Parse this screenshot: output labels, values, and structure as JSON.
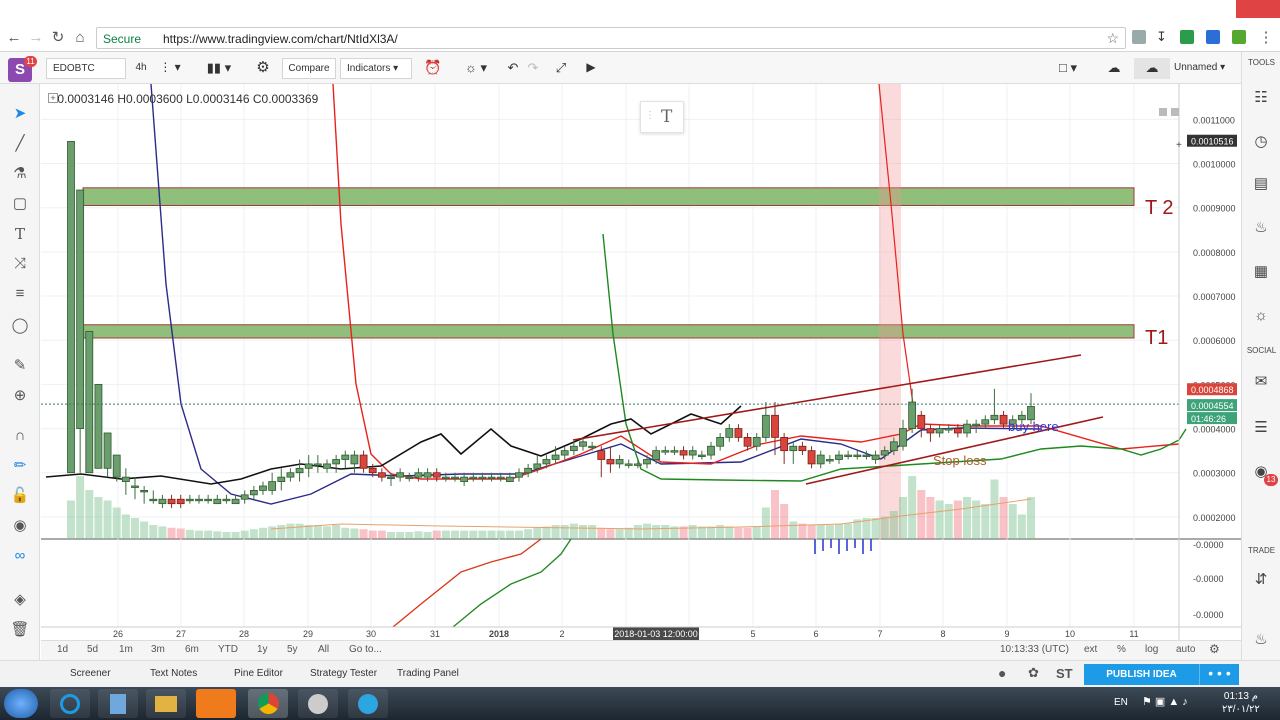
{
  "browser": {
    "secure_label": "Secure",
    "url": "https://www.tradingview.com/chart/NtIdXl3A/"
  },
  "toolbar": {
    "symbol": "EDOBTC",
    "interval": "4h",
    "compare_label": "Compare",
    "indicators_label": "Indicators",
    "layout_name": "Unnamed",
    "notification_count": "11"
  },
  "legend": {
    "ohlc": "O0.0003146  H0.0003600  L0.0003146  C0.0003369"
  },
  "text_tool_glyph": "T",
  "right_rail": {
    "tools_label": "TOOLS",
    "social_label": "SOCIAL",
    "trade_label": "TRADE",
    "social_badge": "13"
  },
  "bottom_bar": {
    "ranges": [
      "1d",
      "5d",
      "1m",
      "3m",
      "6m",
      "YTD",
      "1y",
      "5y",
      "All"
    ],
    "goto_label": "Go to...",
    "time_utc": "10:13:33 (UTC)",
    "ext_label": "ext",
    "pct_label": "%",
    "log_label": "log",
    "auto_label": "auto"
  },
  "footer": {
    "tabs": [
      "Screener",
      "Text Notes",
      "Pine Editor",
      "Strategy Tester",
      "Trading Panel"
    ],
    "st_label": "ST",
    "publish_label": "PUBLISH IDEA",
    "more_label": "• • •"
  },
  "taskbar": {
    "lang": "EN",
    "time": "01:13 م",
    "date": "٢٣/٠١/٢٢"
  },
  "colors": {
    "up_candle": "#6a9e6c",
    "down_candle": "#d9453b",
    "target_zone": "#8fbf7a",
    "accent_blue": "#1e9be6",
    "trendline": "#a01818"
  },
  "chart_data": {
    "type": "candlestick",
    "symbol": "EDOBTC",
    "interval": "4h",
    "x_tick_labels": [
      "26",
      "27",
      "28",
      "29",
      "30",
      "31",
      "2018",
      "2",
      "2018-01-03 12:00:00",
      "5",
      "6",
      "7",
      "8",
      "9",
      "10",
      "11"
    ],
    "y_tick_labels": [
      "0.0011000",
      "0.0010000",
      "0.0009000",
      "0.0008000",
      "0.0007000",
      "0.0006000",
      "0.0005000",
      "0.0004000",
      "0.0003000",
      "0.0002000"
    ],
    "ylim": [
      0.00015,
      0.00118
    ],
    "price_labels": [
      "0.0010516",
      "0.0004868",
      "0.0004554",
      "01:46:26"
    ],
    "oscillator_tick_labels": [
      "-0.0000",
      "-0.0000",
      "-0.0000"
    ],
    "annotations": {
      "t2_label": "T 2",
      "t1_label": "T1",
      "buy_label": "buy here",
      "stop_label": "Stop loss"
    },
    "zones": [
      {
        "name": "T 2",
        "low": 0.000905,
        "high": 0.000945
      },
      {
        "name": "T1",
        "low": 0.000605,
        "high": 0.000635
      }
    ],
    "candles": [
      [
        0.0003,
        0.00105,
        0.00105,
        0.0004
      ],
      [
        0.0004,
        0.00094,
        0.00094,
        0.0003
      ],
      [
        0.0003,
        0.00062,
        0.00062,
        0.00031
      ],
      [
        0.00031,
        0.0005,
        0.0005,
        0.00031
      ],
      [
        0.00031,
        0.00039,
        0.00039,
        0.00029
      ],
      [
        0.00029,
        0.00034,
        0.00034,
        0.00028
      ],
      [
        0.00028,
        0.00029,
        0.00031,
        0.00025
      ],
      [
        0.00027,
        0.00027,
        0.00029,
        0.00024
      ],
      [
        0.00026,
        0.00026,
        0.00027,
        0.00023
      ],
      [
        0.00024,
        0.00024,
        0.00026,
        0.00023
      ],
      [
        0.00023,
        0.00024,
        0.00025,
        0.00022
      ],
      [
        0.00024,
        0.00023,
        0.00025,
        0.00022
      ],
      [
        0.00024,
        0.00023,
        0.00025,
        0.00022
      ],
      [
        0.00024,
        0.00024,
        0.00025,
        0.00023
      ],
      [
        0.00024,
        0.00024,
        0.00025,
        0.00023
      ],
      [
        0.00024,
        0.00024,
        0.00025,
        0.00023
      ],
      [
        0.00023,
        0.00024,
        0.00025,
        0.00023
      ],
      [
        0.00024,
        0.00024,
        0.00025,
        0.00023
      ],
      [
        0.00023,
        0.00024,
        0.00025,
        0.00023
      ],
      [
        0.00024,
        0.00025,
        0.00026,
        0.00023
      ],
      [
        0.00025,
        0.00026,
        0.00027,
        0.00024
      ],
      [
        0.00026,
        0.00027,
        0.00028,
        0.00025
      ],
      [
        0.00026,
        0.00028,
        0.0003,
        0.00025
      ],
      [
        0.00028,
        0.00029,
        0.00031,
        0.00026
      ],
      [
        0.00029,
        0.0003,
        0.00031,
        0.00028
      ],
      [
        0.0003,
        0.00031,
        0.00033,
        0.00028
      ],
      [
        0.00031,
        0.00032,
        0.00034,
        0.00029
      ],
      [
        0.00032,
        0.00032,
        0.00034,
        0.0003
      ],
      [
        0.00031,
        0.00032,
        0.00033,
        0.0003
      ],
      [
        0.00032,
        0.00033,
        0.00034,
        0.0003
      ],
      [
        0.00033,
        0.00034,
        0.00035,
        0.00031
      ],
      [
        0.00032,
        0.00034,
        0.00035,
        0.0003
      ],
      [
        0.00034,
        0.00031,
        0.00035,
        0.0003
      ],
      [
        0.00031,
        0.0003,
        0.00032,
        0.00029
      ],
      [
        0.0003,
        0.00029,
        0.00031,
        0.00028
      ],
      [
        0.00029,
        0.00029,
        0.0003,
        0.00027
      ],
      [
        0.00029,
        0.0003,
        0.00031,
        0.00028
      ],
      [
        0.00029,
        0.00029,
        0.0003,
        0.00028
      ],
      [
        0.00029,
        0.0003,
        0.00031,
        0.00028
      ],
      [
        0.00029,
        0.0003,
        0.00031,
        0.00028
      ],
      [
        0.0003,
        0.00029,
        0.00031,
        0.00028
      ],
      [
        0.00029,
        0.00029,
        0.0003,
        0.00028
      ],
      [
        0.00029,
        0.00029,
        0.0003,
        0.00028
      ],
      [
        0.00028,
        0.00029,
        0.0003,
        0.00027
      ],
      [
        0.00029,
        0.00029,
        0.0003,
        0.00028
      ],
      [
        0.00029,
        0.00029,
        0.0003,
        0.00028
      ],
      [
        0.00029,
        0.00029,
        0.0003,
        0.00028
      ],
      [
        0.00029,
        0.00029,
        0.0003,
        0.00028
      ],
      [
        0.00028,
        0.00029,
        0.0003,
        0.00028
      ],
      [
        0.00029,
        0.0003,
        0.00031,
        0.00028
      ],
      [
        0.0003,
        0.00031,
        0.00032,
        0.00029
      ],
      [
        0.00031,
        0.00032,
        0.00034,
        0.0003
      ],
      [
        0.00032,
        0.00033,
        0.00034,
        0.00031
      ],
      [
        0.00033,
        0.00034,
        0.00036,
        0.00032
      ],
      [
        0.00034,
        0.00035,
        0.00036,
        0.00033
      ],
      [
        0.00035,
        0.00036,
        0.00037,
        0.00034
      ],
      [
        0.00036,
        0.00037,
        0.00038,
        0.00035
      ],
      [
        0.00036,
        0.00036,
        0.00037,
        0.00035
      ],
      [
        0.00035,
        0.00033,
        0.00036,
        0.00029
      ],
      [
        0.00033,
        0.00032,
        0.00036,
        0.0003
      ],
      [
        0.00032,
        0.00033,
        0.00034,
        0.00031
      ],
      [
        0.00032,
        0.00032,
        0.00033,
        0.00031
      ],
      [
        0.00032,
        0.00032,
        0.00033,
        0.00031
      ],
      [
        0.00032,
        0.00033,
        0.00034,
        0.00031
      ],
      [
        0.00033,
        0.00035,
        0.00036,
        0.00032
      ],
      [
        0.00035,
        0.00035,
        0.00036,
        0.00034
      ],
      [
        0.00035,
        0.00035,
        0.00036,
        0.00034
      ],
      [
        0.00035,
        0.00034,
        0.00036,
        0.00033
      ],
      [
        0.00034,
        0.00035,
        0.00036,
        0.00033
      ],
      [
        0.00034,
        0.00034,
        0.00035,
        0.00033
      ],
      [
        0.00034,
        0.00036,
        0.00037,
        0.00033
      ],
      [
        0.00036,
        0.00038,
        0.00039,
        0.00035
      ],
      [
        0.00038,
        0.0004,
        0.00041,
        0.00037
      ],
      [
        0.0004,
        0.00038,
        0.00041,
        0.00037
      ],
      [
        0.00038,
        0.00036,
        0.00039,
        0.00035
      ],
      [
        0.00036,
        0.00038,
        0.00039,
        0.00035
      ],
      [
        0.00038,
        0.00043,
        0.00046,
        0.00037
      ],
      [
        0.00043,
        0.00038,
        0.00046,
        0.00034
      ],
      [
        0.00038,
        0.00035,
        0.00039,
        0.00032
      ],
      [
        0.00035,
        0.00036,
        0.00037,
        0.00032
      ],
      [
        0.00036,
        0.00035,
        0.00037,
        0.00034
      ],
      [
        0.00035,
        0.00032,
        0.00036,
        0.00031
      ],
      [
        0.00032,
        0.00034,
        0.00035,
        0.00031
      ],
      [
        0.00033,
        0.00033,
        0.00034,
        0.00032
      ],
      [
        0.00033,
        0.00034,
        0.00035,
        0.00032
      ],
      [
        0.00034,
        0.00034,
        0.00035,
        0.00033
      ],
      [
        0.00034,
        0.00034,
        0.00035,
        0.00033
      ],
      [
        0.00034,
        0.00034,
        0.00035,
        0.00033
      ],
      [
        0.00033,
        0.00034,
        0.00035,
        0.00032
      ],
      [
        0.00034,
        0.00035,
        0.00036,
        0.00033
      ],
      [
        0.00035,
        0.00037,
        0.00038,
        0.00034
      ],
      [
        0.00036,
        0.0004,
        0.00042,
        0.00035
      ],
      [
        0.0004,
        0.00046,
        0.00049,
        0.00039
      ],
      [
        0.00043,
        0.0004,
        0.00044,
        0.00038
      ],
      [
        0.0004,
        0.00039,
        0.00041,
        0.00037
      ],
      [
        0.00039,
        0.0004,
        0.00041,
        0.00038
      ],
      [
        0.0004,
        0.0004,
        0.00041,
        0.00039
      ],
      [
        0.0004,
        0.00039,
        0.00041,
        0.00038
      ],
      [
        0.00039,
        0.00041,
        0.00042,
        0.00038
      ],
      [
        0.00041,
        0.00041,
        0.00042,
        0.00039
      ],
      [
        0.00041,
        0.00042,
        0.00043,
        0.0004
      ],
      [
        0.00042,
        0.00043,
        0.00049,
        0.00041
      ],
      [
        0.00043,
        0.00041,
        0.00044,
        0.0004
      ],
      [
        0.00041,
        0.00042,
        0.00043,
        0.0004
      ],
      [
        0.00042,
        0.00043,
        0.00044,
        0.00041
      ],
      [
        0.00042,
        0.00045,
        0.00048,
        0.00041
      ]
    ],
    "volume": [
      0.55,
      0.9,
      0.7,
      0.6,
      0.55,
      0.45,
      0.35,
      0.3,
      0.25,
      0.2,
      0.18,
      0.16,
      0.15,
      0.13,
      0.12,
      0.12,
      0.11,
      0.1,
      0.1,
      0.12,
      0.14,
      0.16,
      0.18,
      0.2,
      0.22,
      0.22,
      0.2,
      0.2,
      0.18,
      0.2,
      0.16,
      0.15,
      0.14,
      0.12,
      0.12,
      0.1,
      0.1,
      0.1,
      0.11,
      0.1,
      0.12,
      0.12,
      0.12,
      0.12,
      0.12,
      0.12,
      0.12,
      0.12,
      0.12,
      0.12,
      0.14,
      0.16,
      0.18,
      0.2,
      0.2,
      0.22,
      0.2,
      0.2,
      0.16,
      0.14,
      0.14,
      0.16,
      0.2,
      0.22,
      0.2,
      0.2,
      0.18,
      0.18,
      0.2,
      0.18,
      0.18,
      0.2,
      0.18,
      0.16,
      0.16,
      0.18,
      0.45,
      0.7,
      0.5,
      0.25,
      0.22,
      0.2,
      0.2,
      0.2,
      0.22,
      0.22,
      0.28,
      0.3,
      0.3,
      0.32,
      0.4,
      0.6,
      0.9,
      0.7,
      0.6,
      0.55,
      0.5,
      0.55,
      0.6,
      0.55,
      0.5,
      0.85,
      0.6,
      0.5,
      0.35,
      0.6
    ]
  }
}
